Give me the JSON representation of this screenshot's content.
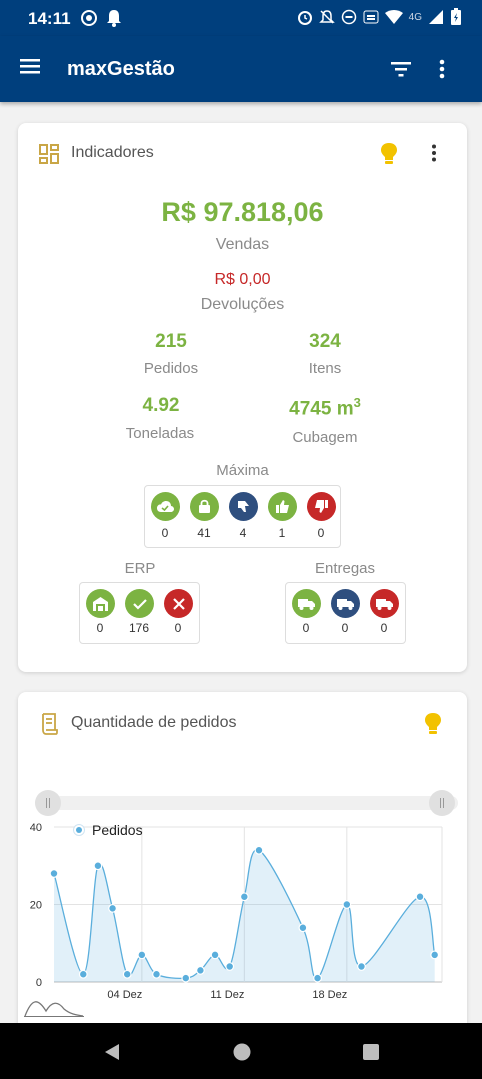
{
  "status_bar": {
    "time": "14:11",
    "network_label": "4G"
  },
  "app_bar": {
    "title": "maxGestão"
  },
  "indicators": {
    "title": "Indicadores",
    "sales_value": "R$ 97.818,06",
    "sales_label": "Vendas",
    "returns_value": "R$ 0,00",
    "returns_label": "Devoluções",
    "orders_value": "215",
    "orders_label": "Pedidos",
    "items_value": "324",
    "items_label": "Itens",
    "tons_value": "4.92",
    "tons_label": "Toneladas",
    "cubage_value": "4745 m",
    "cubage_sup": "3",
    "cubage_label": "Cubagem",
    "maxima_label": "Máxima",
    "maxima_counts": [
      "0",
      "41",
      "4",
      "1",
      "0"
    ],
    "erp_label": "ERP",
    "erp_counts": [
      "0",
      "176",
      "0"
    ],
    "entregas_label": "Entregas",
    "entregas_counts": [
      "0",
      "0",
      "0"
    ]
  },
  "orders_chart_card": {
    "title": "Quantidade de pedidos"
  },
  "chart_data": {
    "type": "area",
    "title": "",
    "legend": {
      "entries": [
        "Pedidos"
      ],
      "placement": "top-left"
    },
    "y_ticks": [
      "0",
      "20",
      "40"
    ],
    "ylim": [
      0,
      40
    ],
    "x_tick_labels": [
      "04 Dez",
      "11 Dez",
      "18 Dez"
    ],
    "x_range": [
      0,
      26.5
    ],
    "x_tick_positions": [
      6,
      13,
      20
    ],
    "grid": true,
    "series": [
      {
        "name": "Pedidos",
        "color": "#5aaedc",
        "x": [
          0,
          2,
          3,
          4,
          5,
          6,
          7,
          9,
          10,
          11,
          12,
          13,
          14,
          17,
          18,
          20,
          21,
          25,
          26
        ],
        "values": [
          28,
          2,
          30,
          19,
          2,
          7,
          2,
          1,
          3,
          7,
          4,
          22,
          34,
          14,
          1,
          20,
          4,
          22,
          7
        ]
      }
    ]
  },
  "colors": {
    "primary": "#003f7d",
    "green": "#7cb342",
    "red": "#c62828",
    "navy": "#2f4f7f",
    "bulb": "#f2c200"
  }
}
